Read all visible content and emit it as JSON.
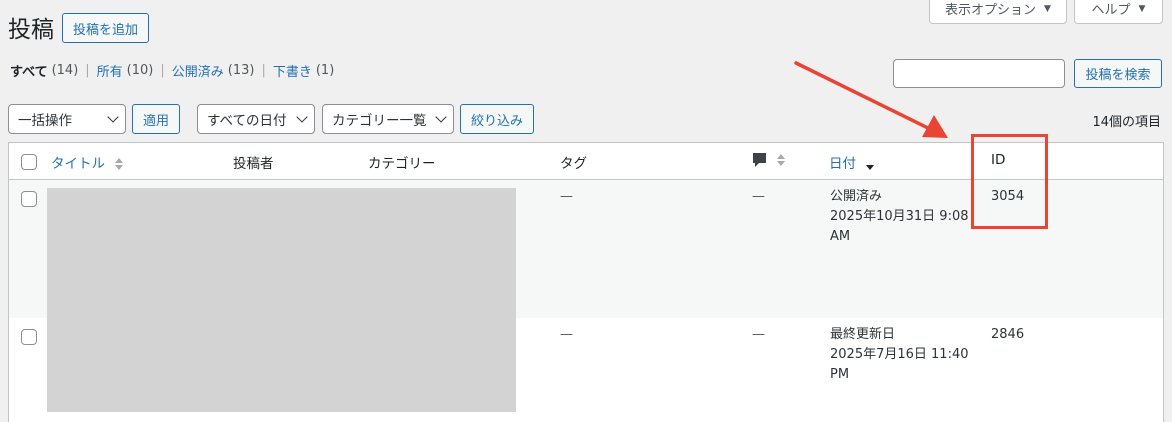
{
  "header": {
    "title": "投稿",
    "add_new_label": "投稿を追加",
    "screen_options_label": "表示オプション",
    "help_label": "ヘルプ"
  },
  "filters": {
    "views": [
      {
        "label": "すべて",
        "count": "(14)",
        "current": true
      },
      {
        "label": "所有",
        "count": "(10)"
      },
      {
        "label": "公開済み",
        "count": "(13)"
      },
      {
        "label": "下書き",
        "count": "(1)"
      }
    ],
    "search_button_label": "投稿を検索",
    "bulk_action_value": "一括操作",
    "apply_label": "適用",
    "date_filter_value": "すべての日付",
    "category_filter_value": "カテゴリー一覧",
    "filter_button_label": "絞り込み",
    "items_count": "14個の項目"
  },
  "table": {
    "columns": {
      "title": "タイトル",
      "author": "投稿者",
      "categories": "カテゴリー",
      "tags": "タグ",
      "date": "日付",
      "id": "ID"
    },
    "rows": [
      {
        "tags": "—",
        "comments": "—",
        "status": "公開済み",
        "date_line1": "2025年10月31日 9:08",
        "date_line2": "AM",
        "id": "3054"
      },
      {
        "tags": "—",
        "comments": "—",
        "status": "最終更新日",
        "date_line1": "2025年7月16日 11:40",
        "date_line2": "PM",
        "id": "2846"
      }
    ]
  },
  "colors": {
    "accent": "#2271b1",
    "annotation": "#e94532"
  }
}
